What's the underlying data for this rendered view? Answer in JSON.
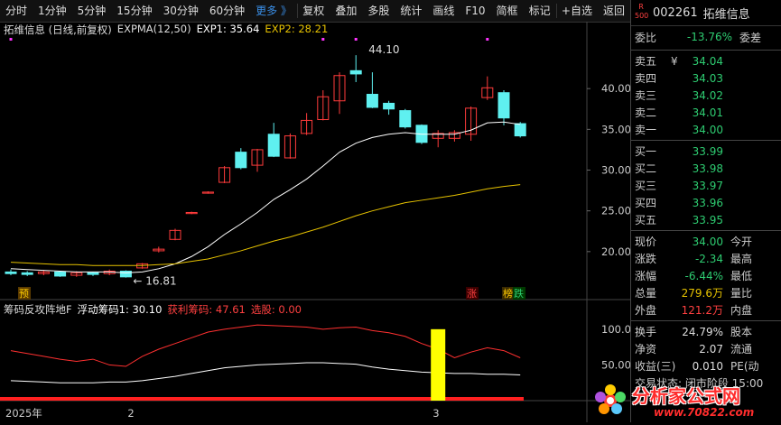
{
  "toolbar": {
    "items": [
      "分时",
      "1分钟",
      "5分钟",
      "15分钟",
      "30分钟",
      "60分钟",
      "更多 》",
      "复权",
      "叠加",
      "多股",
      "统计",
      "画线",
      "F10",
      "简框",
      "标记",
      "+自选",
      "返回"
    ]
  },
  "main_legend": {
    "stock": "拓维信息 (日线,前复权)",
    "indicator": "EXPMA(12,50)",
    "exp1": "EXP1: 35.64",
    "exp2": "EXP2: 28.21"
  },
  "annotations": {
    "high": "44.10",
    "low": "16.81",
    "pre_tag": "预",
    "zhang_tag": "涨",
    "bang_tag": "榜",
    "die_tag": "跌"
  },
  "price_axis": [
    "40.00",
    "35.00",
    "30.00",
    "25.00",
    "20.00"
  ],
  "sub_legend": {
    "name": "筹码反攻阵地F",
    "float": "浮动筹码1: 30.10",
    "profit": "获利筹码: 47.61",
    "select": "选股: 0.00"
  },
  "sub_axis": [
    "100.0",
    "50.00"
  ],
  "date_axis": [
    "2025年",
    "2",
    "3"
  ],
  "side": {
    "badge_top": "R",
    "badge_bottom": "500",
    "code": "002261",
    "name": "拓维信息",
    "weibi_label": "委比",
    "weibi_value": "-13.76%",
    "weicha_label": "委差",
    "asks": [
      {
        "label": "卖五",
        "price": "34.04",
        "mark": "¥"
      },
      {
        "label": "卖四",
        "price": "34.03",
        "mark": ""
      },
      {
        "label": "卖三",
        "price": "34.02",
        "mark": ""
      },
      {
        "label": "卖二",
        "price": "34.01",
        "mark": ""
      },
      {
        "label": "卖一",
        "price": "34.00",
        "mark": ""
      }
    ],
    "bids": [
      {
        "label": "买一",
        "price": "33.99"
      },
      {
        "label": "买二",
        "price": "33.98"
      },
      {
        "label": "买三",
        "price": "33.97"
      },
      {
        "label": "买四",
        "price": "33.96"
      },
      {
        "label": "买五",
        "price": "33.95"
      }
    ],
    "quote": [
      {
        "l": "现价",
        "v": "34.00",
        "r": "今开",
        "c": "green"
      },
      {
        "l": "涨跌",
        "v": "-2.34",
        "r": "最高",
        "c": "green"
      },
      {
        "l": "涨幅",
        "v": "-6.44%",
        "r": "最低",
        "c": "green"
      },
      {
        "l": "总量",
        "v": "279.6万",
        "r": "量比",
        "c": "yellow"
      },
      {
        "l": "外盘",
        "v": "121.2万",
        "r": "内盘",
        "c": "red"
      }
    ],
    "stats": [
      {
        "l": "换手",
        "v": "24.79%",
        "r": "股本"
      },
      {
        "l": "净资",
        "v": "2.07",
        "r": "流通"
      },
      {
        "l": "收益(三)",
        "v": "0.010",
        "r": "PE(动"
      }
    ],
    "stage": "交易状态: 闭市阶段 15:00"
  },
  "watermark": {
    "title": "分析家公式网",
    "url": "www.70822.com"
  },
  "chart_data": {
    "type": "candlestick",
    "candles": [
      {
        "o": 17.5,
        "c": 17.3,
        "h": 17.8,
        "l": 17.1
      },
      {
        "o": 17.4,
        "c": 17.2,
        "h": 17.6,
        "l": 17.0
      },
      {
        "o": 17.3,
        "c": 17.5,
        "h": 17.7,
        "l": 17.1
      },
      {
        "o": 17.5,
        "c": 17.0,
        "h": 17.6,
        "l": 16.9
      },
      {
        "o": 17.1,
        "c": 17.4,
        "h": 17.6,
        "l": 16.9
      },
      {
        "o": 17.4,
        "c": 17.2,
        "h": 17.5,
        "l": 17.0
      },
      {
        "o": 17.3,
        "c": 17.6,
        "h": 17.8,
        "l": 17.1
      },
      {
        "o": 17.6,
        "c": 16.9,
        "h": 17.7,
        "l": 16.81
      },
      {
        "o": 18.0,
        "c": 18.5,
        "h": 18.6,
        "l": 17.9
      },
      {
        "o": 20.1,
        "c": 20.3,
        "h": 20.6,
        "l": 19.9
      },
      {
        "o": 21.5,
        "c": 22.6,
        "h": 22.8,
        "l": 21.4
      },
      {
        "o": 24.7,
        "c": 24.8,
        "h": 24.9,
        "l": 24.6
      },
      {
        "o": 27.2,
        "c": 27.3,
        "h": 27.4,
        "l": 27.1
      },
      {
        "o": 28.5,
        "c": 30.3,
        "h": 30.5,
        "l": 28.4
      },
      {
        "o": 32.2,
        "c": 30.3,
        "h": 32.7,
        "l": 30.1
      },
      {
        "o": 30.6,
        "c": 32.5,
        "h": 32.6,
        "l": 29.8
      },
      {
        "o": 34.4,
        "c": 31.7,
        "h": 35.8,
        "l": 31.6
      },
      {
        "o": 31.5,
        "c": 34.2,
        "h": 34.5,
        "l": 31.4
      },
      {
        "o": 34.5,
        "c": 36.1,
        "h": 37.0,
        "l": 34.3
      },
      {
        "o": 36.2,
        "c": 39.0,
        "h": 39.8,
        "l": 36.1
      },
      {
        "o": 38.5,
        "c": 41.6,
        "h": 42.0,
        "l": 36.9
      },
      {
        "o": 42.2,
        "c": 41.8,
        "h": 44.1,
        "l": 40.8
      },
      {
        "o": 39.3,
        "c": 37.7,
        "h": 42.0,
        "l": 37.6
      },
      {
        "o": 38.2,
        "c": 37.5,
        "h": 38.5,
        "l": 36.8
      },
      {
        "o": 37.3,
        "c": 35.3,
        "h": 37.5,
        "l": 35.1
      },
      {
        "o": 35.5,
        "c": 33.4,
        "h": 35.6,
        "l": 33.2
      },
      {
        "o": 33.9,
        "c": 34.5,
        "h": 34.9,
        "l": 32.8
      },
      {
        "o": 33.9,
        "c": 34.6,
        "h": 34.9,
        "l": 33.5
      },
      {
        "o": 34.4,
        "c": 37.6,
        "h": 37.8,
        "l": 33.6
      },
      {
        "o": 38.9,
        "c": 40.1,
        "h": 41.5,
        "l": 38.6
      },
      {
        "o": 39.5,
        "c": 36.4,
        "h": 39.8,
        "l": 35.5
      },
      {
        "o": 35.7,
        "c": 34.2,
        "h": 35.9,
        "l": 34.0
      }
    ],
    "exp1": [
      17.9,
      17.8,
      17.7,
      17.6,
      17.5,
      17.5,
      17.5,
      17.4,
      17.5,
      17.9,
      18.5,
      19.4,
      20.6,
      22.1,
      23.4,
      24.8,
      26.4,
      27.6,
      28.9,
      30.5,
      32.2,
      33.3,
      34.0,
      34.4,
      34.6,
      34.4,
      34.4,
      34.4,
      34.9,
      35.8,
      35.9,
      35.6
    ],
    "exp2": [
      18.7,
      18.6,
      18.5,
      18.4,
      18.4,
      18.3,
      18.3,
      18.3,
      18.3,
      18.4,
      18.5,
      18.8,
      19.1,
      19.6,
      20.1,
      20.7,
      21.3,
      21.8,
      22.4,
      23.0,
      23.7,
      24.4,
      25.0,
      25.5,
      26.0,
      26.3,
      26.6,
      26.9,
      27.3,
      27.7,
      28.0,
      28.21
    ],
    "sub_red": [
      70,
      66,
      62,
      58,
      55,
      58,
      50,
      48,
      62,
      72,
      80,
      88,
      96,
      100,
      103,
      106,
      105,
      104,
      103,
      100,
      102,
      103,
      98,
      95,
      90,
      80,
      72,
      60,
      68,
      74,
      70,
      60
    ],
    "sub_white": [
      28,
      27,
      26,
      25,
      25,
      25,
      26,
      26,
      28,
      31,
      34,
      38,
      42,
      46,
      48,
      50,
      51,
      52,
      53,
      53,
      52,
      51,
      47,
      44,
      42,
      40,
      39,
      38,
      38,
      37,
      37,
      36
    ],
    "sub_bar_index": 26,
    "price_range": [
      15.0,
      46.0
    ],
    "sub_range": [
      0,
      120
    ]
  }
}
